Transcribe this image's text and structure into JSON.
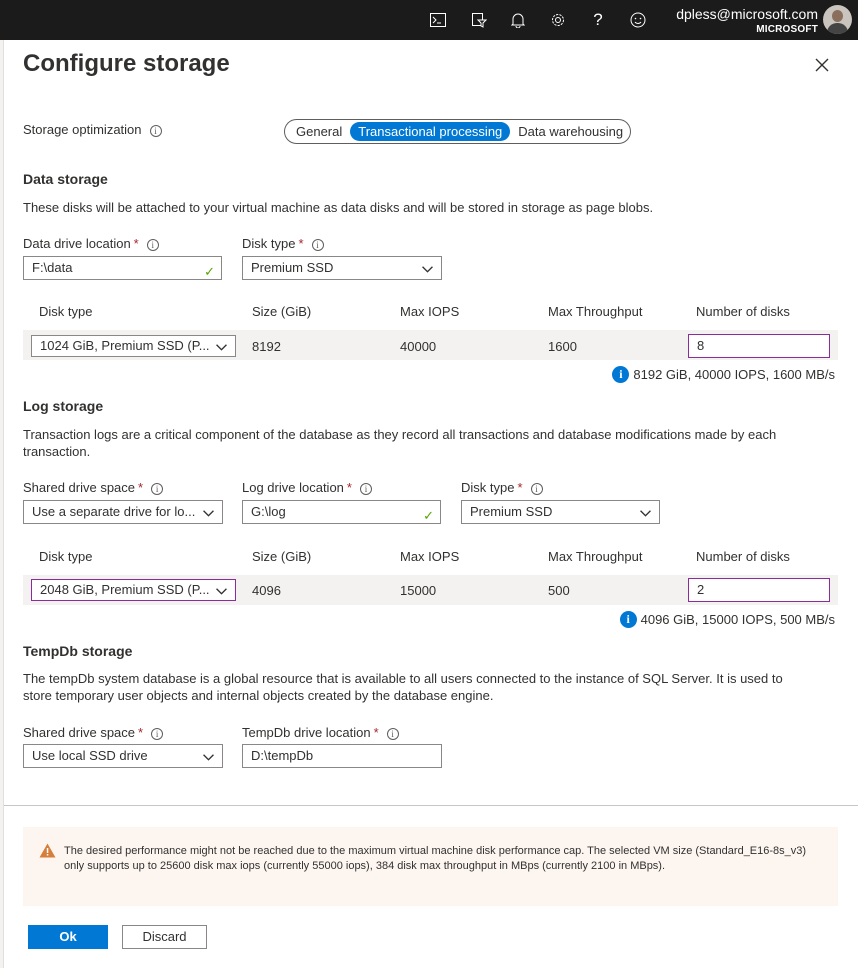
{
  "topbar": {
    "email": "dpless@microsoft.com",
    "tenant": "MICROSOFT",
    "icons": [
      "cloud-shell-icon",
      "directory-filter-icon",
      "notifications-icon",
      "settings-icon",
      "help-icon",
      "feedback-icon"
    ]
  },
  "panel": {
    "title": "Configure storage"
  },
  "optimization": {
    "label": "Storage optimization",
    "options": [
      "General",
      "Transactional processing",
      "Data warehousing"
    ],
    "selected": "Transactional processing"
  },
  "data_storage": {
    "title": "Data storage",
    "description": "These disks will be attached to your virtual machine as data disks and will be stored in storage as page blobs.",
    "location_label": "Data drive location",
    "location_value": "F:\\data",
    "disk_type_label": "Disk type",
    "disk_type_value": "Premium SSD",
    "table": {
      "headers": [
        "Disk type",
        "Size (GiB)",
        "Max IOPS",
        "Max Throughput",
        "Number of disks"
      ],
      "row": {
        "disk_type": "1024 GiB, Premium SSD (P...",
        "size": "8192",
        "iops": "40000",
        "throughput": "1600",
        "disks": "8"
      }
    },
    "summary": "8192 GiB, 40000 IOPS, 1600 MB/s"
  },
  "log_storage": {
    "title": "Log storage",
    "description": "Transaction logs are a critical component of the database as they record all transactions and database modifications made by each transaction.",
    "shared_label": "Shared drive space",
    "shared_value": "Use a separate drive for lo...",
    "location_label": "Log drive location",
    "location_value": "G:\\log",
    "disk_type_label": "Disk type",
    "disk_type_value": "Premium SSD",
    "table": {
      "headers": [
        "Disk type",
        "Size (GiB)",
        "Max IOPS",
        "Max Throughput",
        "Number of disks"
      ],
      "row": {
        "disk_type": "2048 GiB, Premium SSD (P...",
        "size": "4096",
        "iops": "15000",
        "throughput": "500",
        "disks": "2"
      }
    },
    "summary": "4096 GiB, 15000 IOPS, 500 MB/s"
  },
  "tempdb_storage": {
    "title": "TempDb storage",
    "description": "The tempDb system database is a global resource that is available to all users connected to the instance of SQL Server. It is used to store temporary user objects and internal objects created by the database engine.",
    "shared_label": "Shared drive space",
    "shared_value": "Use local SSD drive",
    "location_label": "TempDb drive location",
    "location_value": "D:\\tempDb"
  },
  "warning": {
    "text": "The desired performance might not be reached due to the maximum virtual machine disk performance cap. The selected VM size (Standard_E16-8s_v3) only supports up to 25600 disk max iops (currently 55000 iops), 384 disk max throughput in MBps (currently 2100 in MBps)."
  },
  "buttons": {
    "ok": "Ok",
    "discard": "Discard"
  },
  "colors": {
    "accent": "#0078d4",
    "topbar": "#1b1b1b",
    "warning_bg": "#fdf6f0",
    "valid": "#57a300",
    "required": "#a4262c"
  }
}
